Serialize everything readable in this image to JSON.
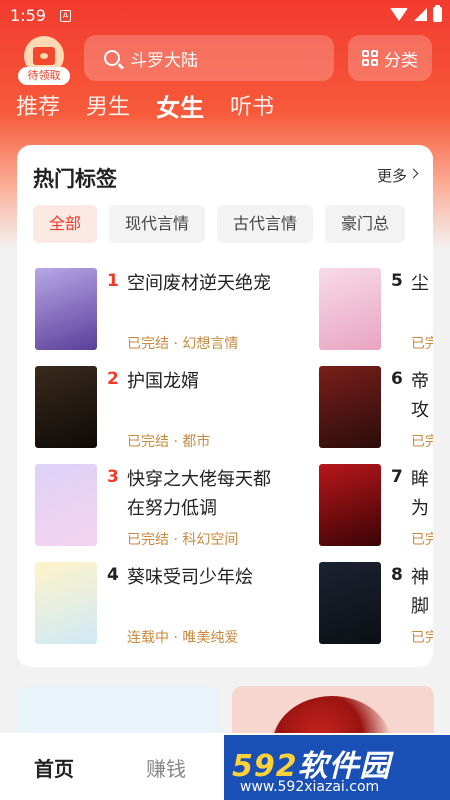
{
  "status_bar": {
    "time": "1:59",
    "notif": "A"
  },
  "top": {
    "gift_label": "待领取",
    "search_placeholder": "斗罗大陆",
    "category_label": "分类"
  },
  "tabs": [
    {
      "label": "推荐",
      "active": false
    },
    {
      "label": "男生",
      "active": false
    },
    {
      "label": "女生",
      "active": true
    },
    {
      "label": "听书",
      "active": false
    }
  ],
  "hot_tags": {
    "title": "热门标签",
    "more": "更多",
    "chips": [
      {
        "label": "全部",
        "active": true
      },
      {
        "label": "现代言情",
        "active": false
      },
      {
        "label": "古代言情",
        "active": false
      },
      {
        "label": "豪门总",
        "active": false
      }
    ],
    "left_books": [
      {
        "rank": "1",
        "name": "空间废材逆天绝宠",
        "status": "已完结",
        "genre": "幻想言情",
        "cover_colors": [
          "#b8a7e6",
          "#5a3f9a"
        ]
      },
      {
        "rank": "2",
        "name": "护国龙婿",
        "status": "已完结",
        "genre": "都市",
        "cover_colors": [
          "#3a2a1d",
          "#0e0a07"
        ]
      },
      {
        "rank": "3",
        "name": "快穿之大佬每天都在努力低调",
        "status": "已完结",
        "genre": "科幻空间",
        "cover_colors": [
          "#dcd2f7",
          "#f6d3f0"
        ]
      },
      {
        "rank": "4",
        "name": "葵味受司少年烩",
        "status": "连载中",
        "genre": "唯美纯爱",
        "cover_colors": [
          "#fff3c8",
          "#cfe9f7"
        ]
      }
    ],
    "right_books": [
      {
        "rank": "5",
        "name": "尘",
        "status": "已完",
        "cover_colors": [
          "#f7dbe6",
          "#e9a4c3"
        ]
      },
      {
        "rank": "6",
        "name": "帝攻",
        "status": "已完",
        "cover_colors": [
          "#7a1e1a",
          "#2a0d0a"
        ]
      },
      {
        "rank": "7",
        "name": "眸为",
        "status": "已完",
        "cover_colors": [
          "#b9161b",
          "#3a0405"
        ]
      },
      {
        "rank": "8",
        "name": "神脚",
        "status": "已完",
        "cover_colors": [
          "#1c2330",
          "#0b0f15"
        ]
      }
    ]
  },
  "bottom_nav": [
    {
      "label": "首页",
      "active": true
    },
    {
      "label": "赚钱",
      "active": false
    }
  ],
  "watermark": {
    "logo_num": "592",
    "logo_text": "软件园",
    "url": "www.592xiazai.com"
  }
}
